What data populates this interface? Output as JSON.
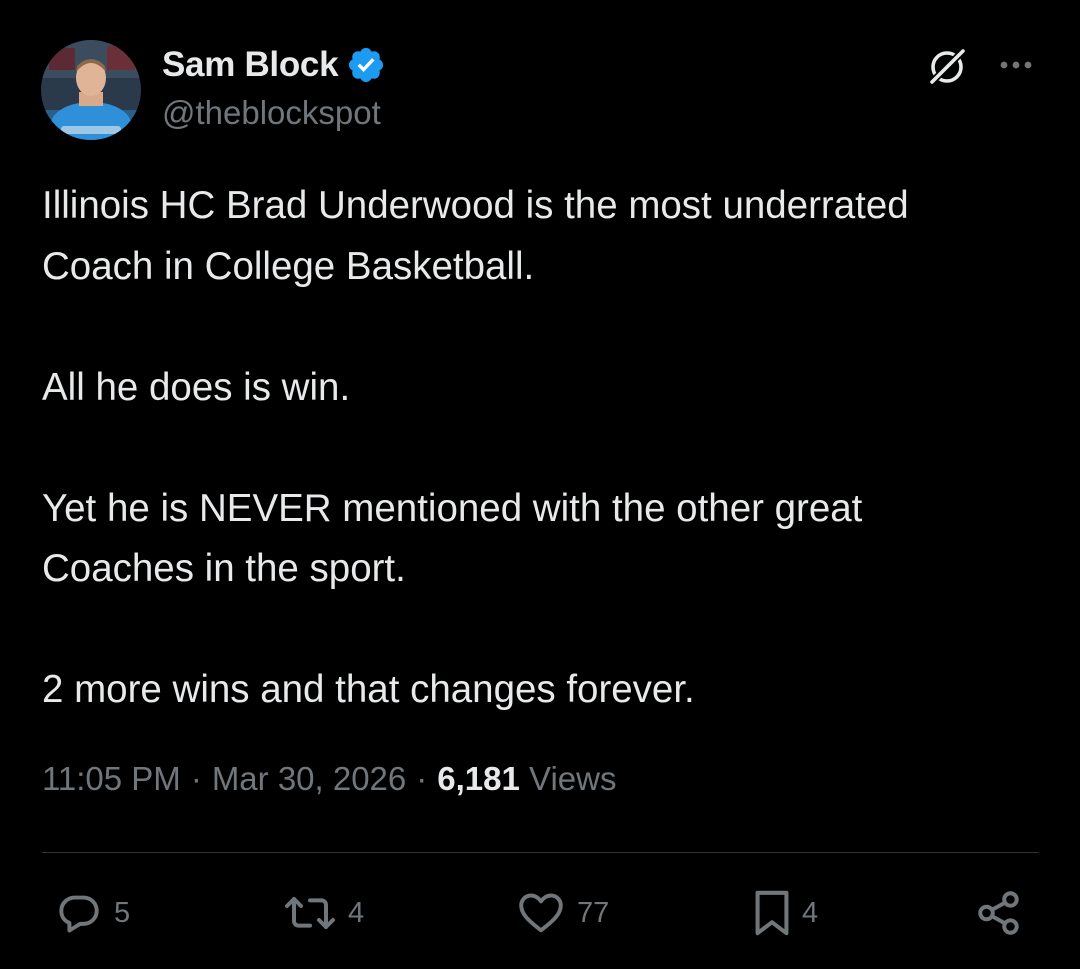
{
  "author": {
    "display_name": "Sam Block",
    "handle": "@theblockspot",
    "verified": true,
    "avatar_icon": "profile-photo"
  },
  "tweet": {
    "paragraphs": [
      "Illinois HC Brad Underwood is the most underrated\nCoach in College Basketball.",
      "All he does is win.",
      "Yet he is NEVER mentioned with the other great\nCoaches in the sport.",
      "2 more wins and that changes forever."
    ],
    "time": "11:05 PM",
    "date": "Mar 30, 2026",
    "views_count": "6,181",
    "views_label": "Views"
  },
  "actions": {
    "reply_count": "5",
    "retweet_count": "4",
    "like_count": "77",
    "bookmark_count": "4"
  },
  "icons": {
    "verified": "verified-badge-icon",
    "grok": "grok-icon",
    "more": "more-icon",
    "reply": "reply-icon",
    "retweet": "retweet-icon",
    "like": "heart-icon",
    "bookmark": "bookmark-icon",
    "share": "share-icon"
  },
  "colors": {
    "background": "#000000",
    "text_primary": "#e7e9ea",
    "text_secondary": "#71767b",
    "verified_blue": "#1d9bf0",
    "divider": "#2f3336"
  }
}
